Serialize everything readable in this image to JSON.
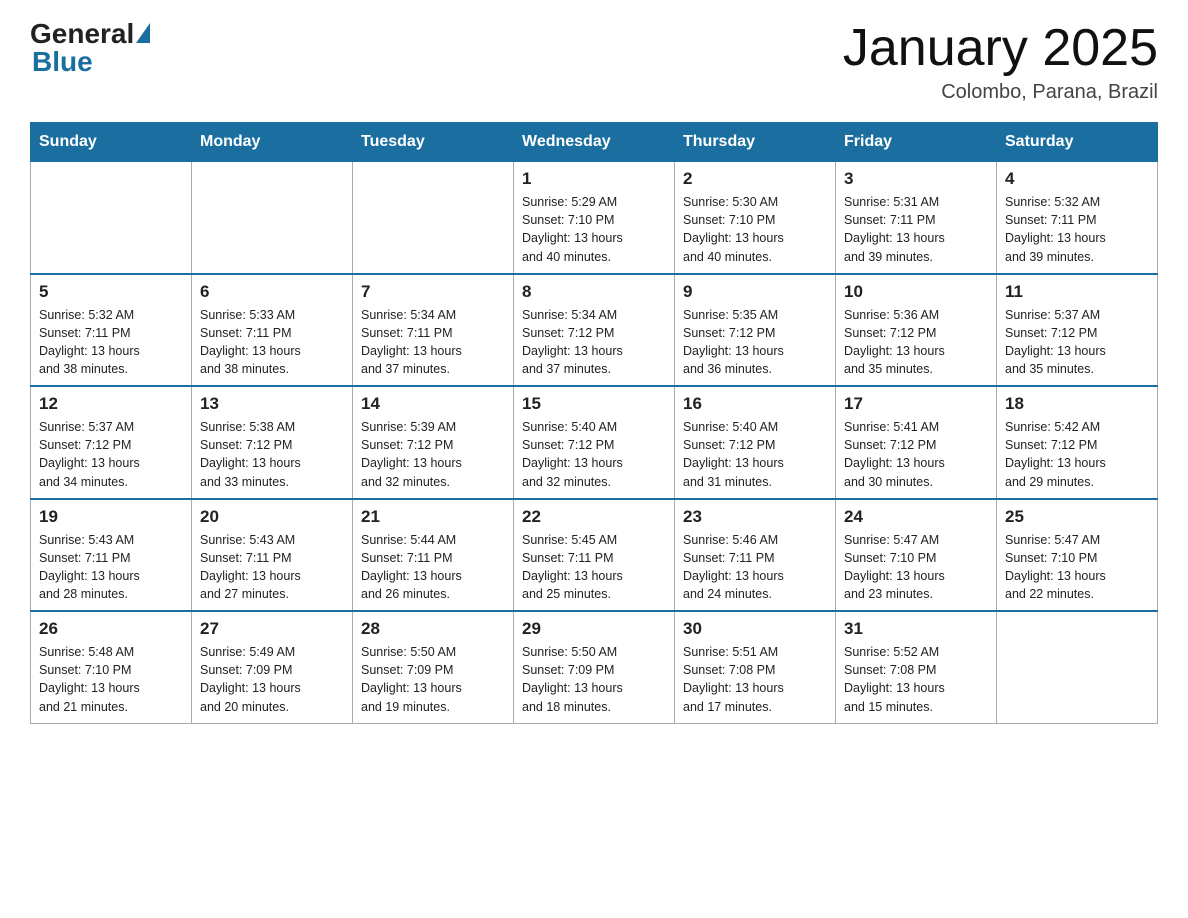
{
  "header": {
    "logo_general": "General",
    "logo_blue": "Blue",
    "month_title": "January 2025",
    "location": "Colombo, Parana, Brazil"
  },
  "days_of_week": [
    "Sunday",
    "Monday",
    "Tuesday",
    "Wednesday",
    "Thursday",
    "Friday",
    "Saturday"
  ],
  "weeks": [
    [
      {
        "day": "",
        "info": ""
      },
      {
        "day": "",
        "info": ""
      },
      {
        "day": "",
        "info": ""
      },
      {
        "day": "1",
        "info": "Sunrise: 5:29 AM\nSunset: 7:10 PM\nDaylight: 13 hours\nand 40 minutes."
      },
      {
        "day": "2",
        "info": "Sunrise: 5:30 AM\nSunset: 7:10 PM\nDaylight: 13 hours\nand 40 minutes."
      },
      {
        "day": "3",
        "info": "Sunrise: 5:31 AM\nSunset: 7:11 PM\nDaylight: 13 hours\nand 39 minutes."
      },
      {
        "day": "4",
        "info": "Sunrise: 5:32 AM\nSunset: 7:11 PM\nDaylight: 13 hours\nand 39 minutes."
      }
    ],
    [
      {
        "day": "5",
        "info": "Sunrise: 5:32 AM\nSunset: 7:11 PM\nDaylight: 13 hours\nand 38 minutes."
      },
      {
        "day": "6",
        "info": "Sunrise: 5:33 AM\nSunset: 7:11 PM\nDaylight: 13 hours\nand 38 minutes."
      },
      {
        "day": "7",
        "info": "Sunrise: 5:34 AM\nSunset: 7:11 PM\nDaylight: 13 hours\nand 37 minutes."
      },
      {
        "day": "8",
        "info": "Sunrise: 5:34 AM\nSunset: 7:12 PM\nDaylight: 13 hours\nand 37 minutes."
      },
      {
        "day": "9",
        "info": "Sunrise: 5:35 AM\nSunset: 7:12 PM\nDaylight: 13 hours\nand 36 minutes."
      },
      {
        "day": "10",
        "info": "Sunrise: 5:36 AM\nSunset: 7:12 PM\nDaylight: 13 hours\nand 35 minutes."
      },
      {
        "day": "11",
        "info": "Sunrise: 5:37 AM\nSunset: 7:12 PM\nDaylight: 13 hours\nand 35 minutes."
      }
    ],
    [
      {
        "day": "12",
        "info": "Sunrise: 5:37 AM\nSunset: 7:12 PM\nDaylight: 13 hours\nand 34 minutes."
      },
      {
        "day": "13",
        "info": "Sunrise: 5:38 AM\nSunset: 7:12 PM\nDaylight: 13 hours\nand 33 minutes."
      },
      {
        "day": "14",
        "info": "Sunrise: 5:39 AM\nSunset: 7:12 PM\nDaylight: 13 hours\nand 32 minutes."
      },
      {
        "day": "15",
        "info": "Sunrise: 5:40 AM\nSunset: 7:12 PM\nDaylight: 13 hours\nand 32 minutes."
      },
      {
        "day": "16",
        "info": "Sunrise: 5:40 AM\nSunset: 7:12 PM\nDaylight: 13 hours\nand 31 minutes."
      },
      {
        "day": "17",
        "info": "Sunrise: 5:41 AM\nSunset: 7:12 PM\nDaylight: 13 hours\nand 30 minutes."
      },
      {
        "day": "18",
        "info": "Sunrise: 5:42 AM\nSunset: 7:12 PM\nDaylight: 13 hours\nand 29 minutes."
      }
    ],
    [
      {
        "day": "19",
        "info": "Sunrise: 5:43 AM\nSunset: 7:11 PM\nDaylight: 13 hours\nand 28 minutes."
      },
      {
        "day": "20",
        "info": "Sunrise: 5:43 AM\nSunset: 7:11 PM\nDaylight: 13 hours\nand 27 minutes."
      },
      {
        "day": "21",
        "info": "Sunrise: 5:44 AM\nSunset: 7:11 PM\nDaylight: 13 hours\nand 26 minutes."
      },
      {
        "day": "22",
        "info": "Sunrise: 5:45 AM\nSunset: 7:11 PM\nDaylight: 13 hours\nand 25 minutes."
      },
      {
        "day": "23",
        "info": "Sunrise: 5:46 AM\nSunset: 7:11 PM\nDaylight: 13 hours\nand 24 minutes."
      },
      {
        "day": "24",
        "info": "Sunrise: 5:47 AM\nSunset: 7:10 PM\nDaylight: 13 hours\nand 23 minutes."
      },
      {
        "day": "25",
        "info": "Sunrise: 5:47 AM\nSunset: 7:10 PM\nDaylight: 13 hours\nand 22 minutes."
      }
    ],
    [
      {
        "day": "26",
        "info": "Sunrise: 5:48 AM\nSunset: 7:10 PM\nDaylight: 13 hours\nand 21 minutes."
      },
      {
        "day": "27",
        "info": "Sunrise: 5:49 AM\nSunset: 7:09 PM\nDaylight: 13 hours\nand 20 minutes."
      },
      {
        "day": "28",
        "info": "Sunrise: 5:50 AM\nSunset: 7:09 PM\nDaylight: 13 hours\nand 19 minutes."
      },
      {
        "day": "29",
        "info": "Sunrise: 5:50 AM\nSunset: 7:09 PM\nDaylight: 13 hours\nand 18 minutes."
      },
      {
        "day": "30",
        "info": "Sunrise: 5:51 AM\nSunset: 7:08 PM\nDaylight: 13 hours\nand 17 minutes."
      },
      {
        "day": "31",
        "info": "Sunrise: 5:52 AM\nSunset: 7:08 PM\nDaylight: 13 hours\nand 15 minutes."
      },
      {
        "day": "",
        "info": ""
      }
    ]
  ]
}
